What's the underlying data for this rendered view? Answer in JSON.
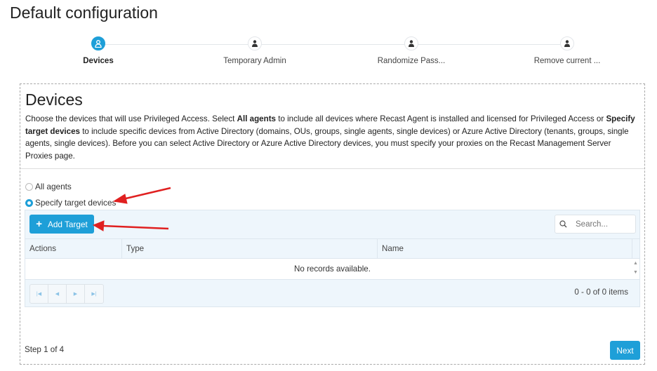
{
  "page_title": "Default configuration",
  "steps": [
    {
      "label": "Devices",
      "active": true
    },
    {
      "label": "Temporary Admin"
    },
    {
      "label": "Randomize Pass..."
    },
    {
      "label": "Remove current ..."
    }
  ],
  "section": {
    "title": "Devices",
    "desc_1": "Choose the devices that will use Privileged Access. Select ",
    "desc_b1": "All agents",
    "desc_2": " to include all devices where Recast Agent is installed and licensed for Privileged Access or ",
    "desc_b2": "Specify target devices",
    "desc_3": " to include specific devices from Active Directory (domains, OUs, groups, single agents, single devices) or Azure Active Directory (tenants, groups, single agents, single devices). Before you can select Active Directory or Azure Active Directory devices, you must specify your proxies on the Recast Management Server Proxies page."
  },
  "radios": [
    {
      "label": "All agents",
      "checked": false
    },
    {
      "label": "Specify target devices",
      "checked": true
    }
  ],
  "grid": {
    "add_label": "Add Target",
    "search_placeholder": "Search...",
    "columns": [
      "Actions",
      "Type",
      "Name"
    ],
    "empty": "No records available.",
    "pager_info": "0 - 0 of 0 items"
  },
  "footer": {
    "step_text": "Step 1 of 4",
    "next_label": "Next"
  },
  "colors": {
    "accent": "#1e9fd8",
    "annotation": "#e02020"
  }
}
